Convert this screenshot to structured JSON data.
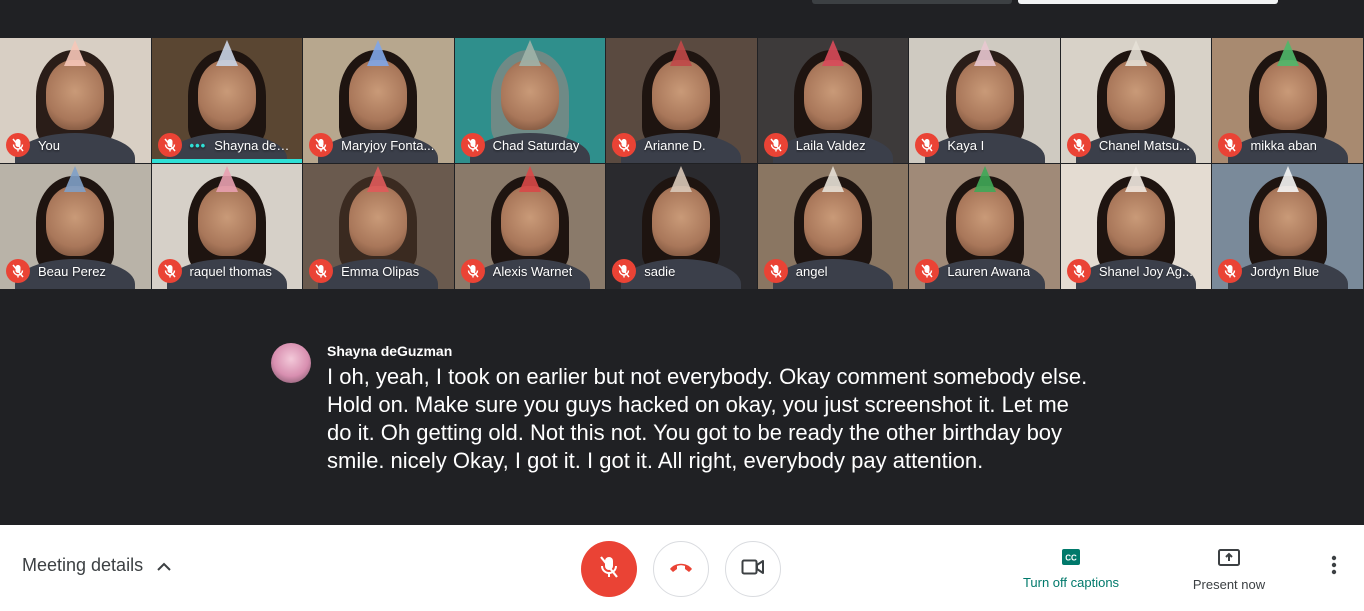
{
  "participants": [
    {
      "name": "You",
      "bg": "#d8cfc4",
      "hat": "#f6c7b8",
      "hair": "#2a1d18"
    },
    {
      "name": "Shayna deGuz...",
      "bg": "#5a4632",
      "hat": "#c9d4e6",
      "hair": "#1e1410",
      "speaking": true
    },
    {
      "name": "Maryjoy Fonta...",
      "bg": "#b7a78e",
      "hat": "#7fa6e8",
      "hair": "#1e1410"
    },
    {
      "name": "Chad Saturday",
      "bg": "#2f8f8c",
      "hat": "#9fb2a8",
      "hair": "#6f8a86"
    },
    {
      "name": "Arianne D.",
      "bg": "#5a4a40",
      "hat": "#c04848",
      "hair": "#1e1410"
    },
    {
      "name": "Laila Valdez",
      "bg": "#3d3a3a",
      "hat": "#d84a5a",
      "hair": "#1e1410"
    },
    {
      "name": "Kaya I",
      "bg": "#cfcac1",
      "hat": "#e8c8d0",
      "hair": "#2a1d18"
    },
    {
      "name": "Chanel Matsu...",
      "bg": "#d8d2c8",
      "hat": "#e6e0d6",
      "hair": "#1e1410"
    },
    {
      "name": "mikka aban",
      "bg": "#a88a70",
      "hat": "#4fb86a",
      "hair": "#1e1410"
    },
    {
      "name": "Beau Perez",
      "bg": "#b9b3a8",
      "hat": "#7fa0c8",
      "hair": "#1e1410"
    },
    {
      "name": "raquel thomas",
      "bg": "#d6d0c8",
      "hat": "#e8a0b0",
      "hair": "#1e1410"
    },
    {
      "name": "Emma Olipas",
      "bg": "#6a5a4e",
      "hat": "#e05a5a",
      "hair": "#3a2a20"
    },
    {
      "name": "Alexis Warnet",
      "bg": "#8a7a6a",
      "hat": "#d84848",
      "hair": "#1e1410"
    },
    {
      "name": "sadie",
      "bg": "#2a2a2e",
      "hat": "#d8c8b8",
      "hair": "#1e1410"
    },
    {
      "name": "angel",
      "bg": "#8a7662",
      "hat": "#e6e0d6",
      "hair": "#1e1410"
    },
    {
      "name": "Lauren Awana",
      "bg": "#a08a78",
      "hat": "#3fa858",
      "hair": "#1e1410"
    },
    {
      "name": "Shanel Joy Ag...",
      "bg": "#e4dcd2",
      "hat": "#f0e8e0",
      "hair": "#1e1410"
    },
    {
      "name": "Jordyn Blue",
      "bg": "#7a8a9a",
      "hat": "#f4f4f4",
      "hair": "#1e1410"
    }
  ],
  "caption": {
    "speaker": "Shayna deGuzman",
    "text": "I oh, yeah, I took on earlier but not everybody. Okay comment somebody else. Hold on. Make sure you guys hacked on okay, you just screenshot it. Let me do it. Oh getting old. Not this not. You got to be ready the other birthday boy smile. nicely Okay, I got it. I got it. All right, everybody pay attention."
  },
  "bottom_bar": {
    "meeting_details": "Meeting details",
    "captions_label": "Turn off captions",
    "present_label": "Present now"
  },
  "icons": {
    "participant_mic": "mic-off-icon",
    "details_toggle": "chevron-up-icon",
    "mic": "mic-off-icon",
    "hangup": "hangup-icon",
    "camera": "videocam-icon",
    "captions": "closed-caption-icon",
    "present": "present-screen-icon",
    "more": "more-vert-icon"
  },
  "colors": {
    "mic_off_red": "#ea4335",
    "speaking_teal": "#2fe0d6",
    "captions_green": "#00796b",
    "stage_bg": "#202124"
  }
}
